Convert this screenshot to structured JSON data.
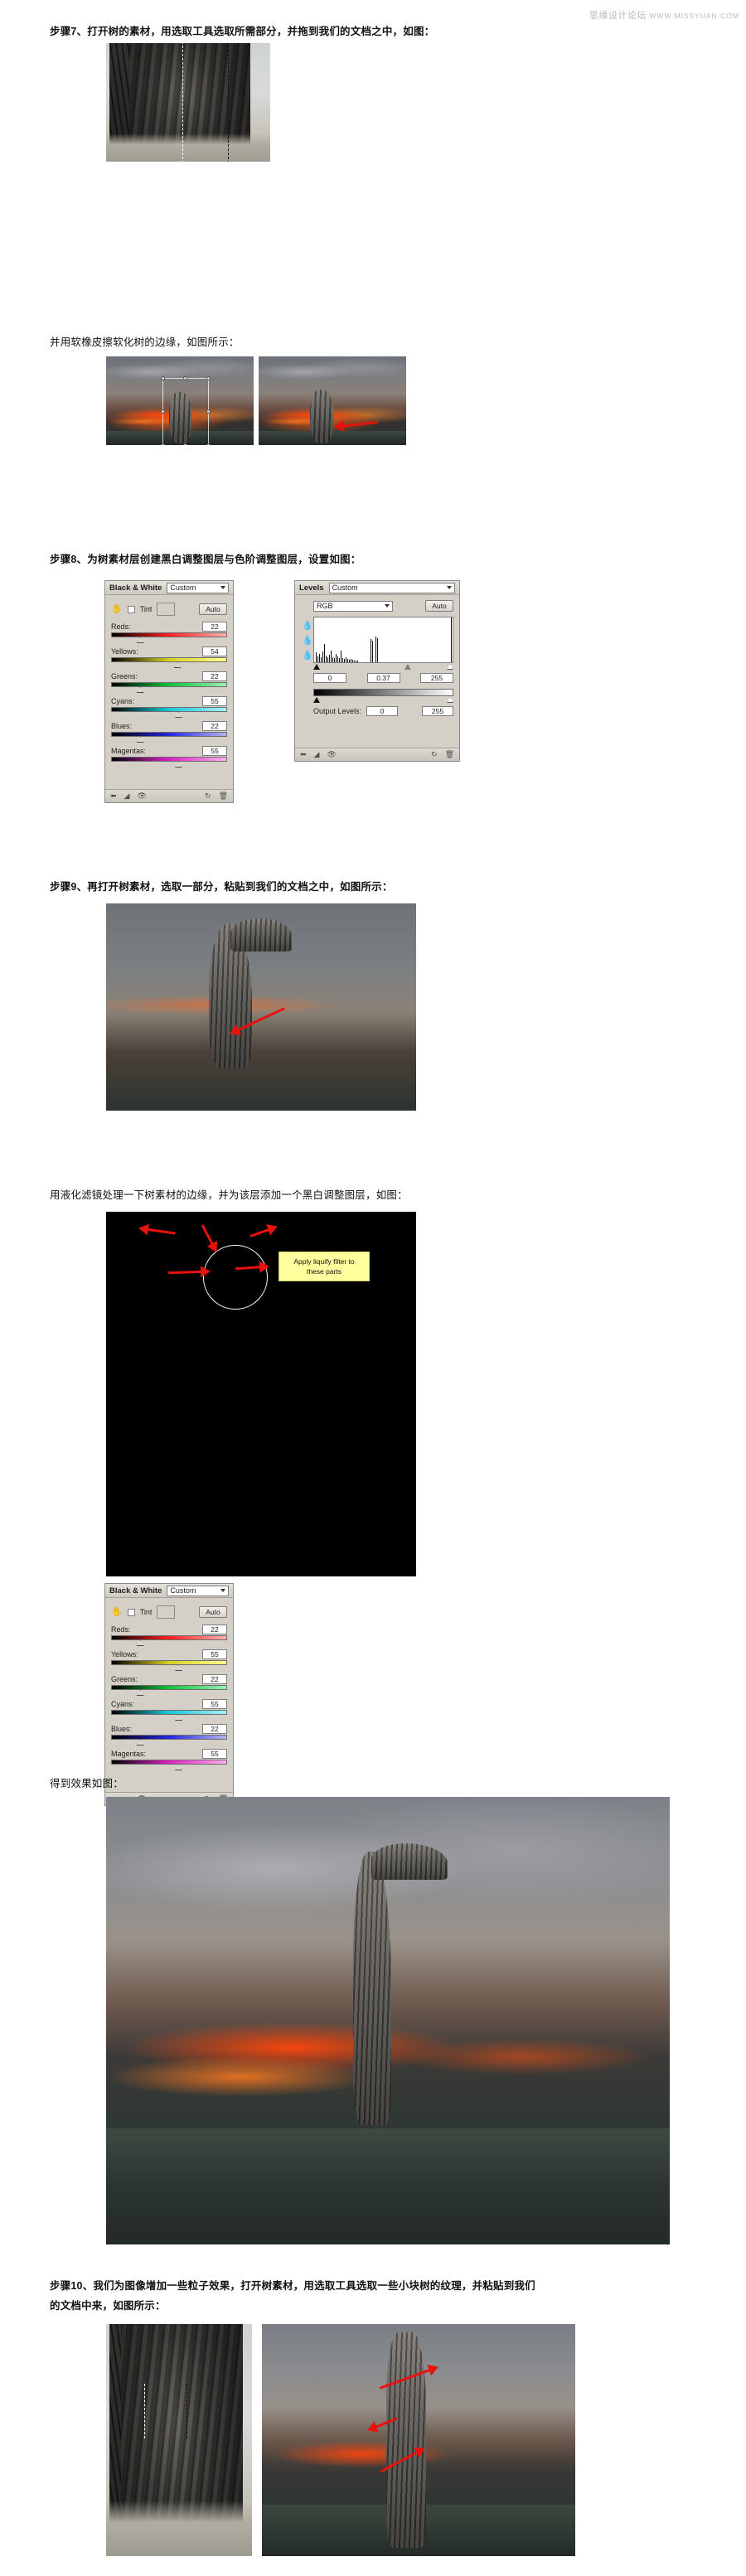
{
  "watermark": {
    "cn": "思缘设计论坛",
    "url": "WWW.MISSYUAN.COM"
  },
  "steps": {
    "step7": "步骤7、打开树的素材，用选取工具选取所需部分，并拖到我们的文档之中，如图：",
    "caption_eraser": "并用软橡皮擦软化树的边缘，如图所示：",
    "step8": "步骤8、为树素材层创建黑白调整图层与色阶调整图层，设置如图：",
    "step9": "步骤9、再打开树素材，选取一部分，粘贴到我们的文档之中，如图所示：",
    "caption_liquify": "用液化滤镜处理一下树素材的边缘，并为该层添加一个黑白调整图层，如图：",
    "caption_result": "得到效果如图：",
    "step10_line1": "步骤10、我们为图像增加一些粒子效果，打开树素材，用选取工具选取一些小块树的纹理，并粘贴到我们",
    "step10_line2": "的文档中来，如图所示："
  },
  "black_white_panel_1": {
    "title": "Black & White",
    "preset": "Custom",
    "tint_label": "Tint",
    "auto_label": "Auto",
    "channels": [
      {
        "label": "Reds:",
        "value": "22",
        "knob_pct": 22
      },
      {
        "label": "Yellows:",
        "value": "54",
        "knob_pct": 54
      },
      {
        "label": "Greens:",
        "value": "22",
        "knob_pct": 22
      },
      {
        "label": "Cyans:",
        "value": "55",
        "knob_pct": 55
      },
      {
        "label": "Blues:",
        "value": "22",
        "knob_pct": 22
      },
      {
        "label": "Magentas:",
        "value": "55",
        "knob_pct": 55
      }
    ]
  },
  "black_white_panel_2": {
    "title": "Black & White",
    "preset": "Custom",
    "tint_label": "Tint",
    "auto_label": "Auto",
    "channels": [
      {
        "label": "Reds:",
        "value": "22",
        "knob_pct": 22
      },
      {
        "label": "Yellows:",
        "value": "55",
        "knob_pct": 55
      },
      {
        "label": "Greens:",
        "value": "22",
        "knob_pct": 22
      },
      {
        "label": "Cyans:",
        "value": "55",
        "knob_pct": 55
      },
      {
        "label": "Blues:",
        "value": "22",
        "knob_pct": 22
      },
      {
        "label": "Magentas:",
        "value": "55",
        "knob_pct": 55
      }
    ]
  },
  "levels_panel": {
    "title": "Levels",
    "preset": "Custom",
    "channel": "RGB",
    "auto_label": "Auto",
    "input_black": "0",
    "input_gamma": "0.37",
    "input_white": "255",
    "output_label": "Output Levels:",
    "output_black": "0",
    "output_white": "255"
  },
  "annotation": {
    "liquify_note": "Apply liquify filter to these parts"
  },
  "colors": {
    "arrow_red": "#e8120c",
    "note_yellow": "#ffff9e",
    "panel_gray": "#d4d0c8",
    "text": "#111111",
    "watermark": "#b9b9b9"
  }
}
